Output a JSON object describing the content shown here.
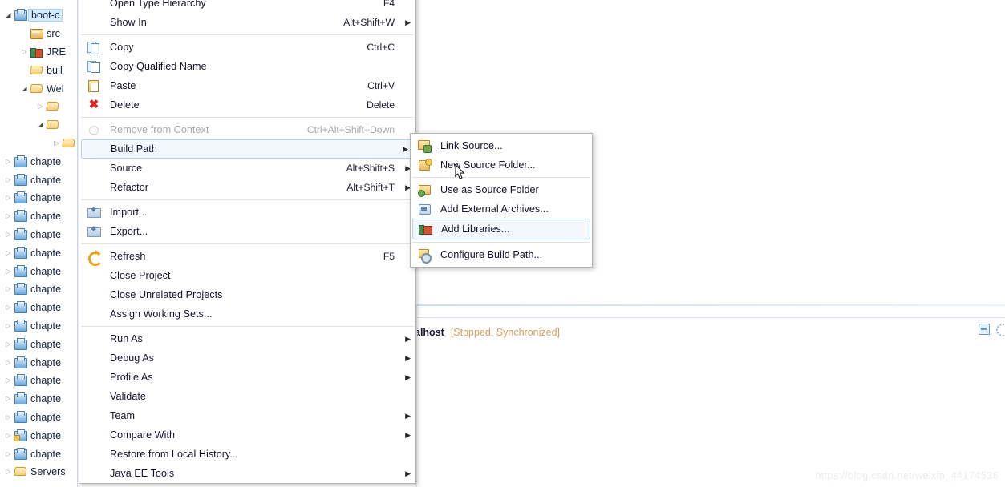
{
  "explorer": {
    "name": "package-explorer",
    "items": [
      {
        "label": "boot-c",
        "icon": "java-project-icon",
        "indent": 0,
        "twisty": "open",
        "selected": true
      },
      {
        "label": "src",
        "icon": "source-folder-icon",
        "indent": 1,
        "twisty": "none",
        "selected": false
      },
      {
        "label": "JRE",
        "icon": "library-icon",
        "indent": 1,
        "twisty": "closed",
        "selected": false
      },
      {
        "label": "buil",
        "icon": "folder-icon",
        "indent": 1,
        "twisty": "none",
        "selected": false
      },
      {
        "label": "Wel",
        "icon": "folder-icon",
        "indent": 1,
        "twisty": "open",
        "selected": false
      },
      {
        "label": "",
        "icon": "folder-icon",
        "indent": 2,
        "twisty": "closed",
        "selected": false
      },
      {
        "label": "",
        "icon": "folder-icon",
        "indent": 2,
        "twisty": "open",
        "selected": false
      },
      {
        "label": "",
        "icon": "folder-icon",
        "indent": 3,
        "twisty": "closed",
        "selected": false
      },
      {
        "label": "chapte",
        "icon": "java-project-icon",
        "indent": 0,
        "twisty": "closed",
        "selected": false
      },
      {
        "label": "chapte",
        "icon": "java-project-icon",
        "indent": 0,
        "twisty": "closed",
        "selected": false
      },
      {
        "label": "chapte",
        "icon": "java-project-icon",
        "indent": 0,
        "twisty": "closed",
        "selected": false
      },
      {
        "label": "chapte",
        "icon": "java-project-icon",
        "indent": 0,
        "twisty": "closed",
        "selected": false
      },
      {
        "label": "chapte",
        "icon": "java-project-icon",
        "indent": 0,
        "twisty": "closed",
        "selected": false
      },
      {
        "label": "chapte",
        "icon": "java-project-icon",
        "indent": 0,
        "twisty": "closed",
        "selected": false
      },
      {
        "label": "chapte",
        "icon": "java-project-icon",
        "indent": 0,
        "twisty": "closed",
        "selected": false
      },
      {
        "label": "chapte",
        "icon": "java-project-icon",
        "indent": 0,
        "twisty": "closed",
        "selected": false
      },
      {
        "label": "chapte",
        "icon": "java-project-icon",
        "indent": 0,
        "twisty": "closed",
        "selected": false
      },
      {
        "label": "chapte",
        "icon": "java-project-icon",
        "indent": 0,
        "twisty": "closed",
        "selected": false
      },
      {
        "label": "chapte",
        "icon": "java-project-icon",
        "indent": 0,
        "twisty": "closed",
        "selected": false
      },
      {
        "label": "chapte",
        "icon": "java-project-icon",
        "indent": 0,
        "twisty": "closed",
        "selected": false
      },
      {
        "label": "chapte",
        "icon": "java-project-icon",
        "indent": 0,
        "twisty": "closed",
        "selected": false
      },
      {
        "label": "chapte",
        "icon": "java-project-icon",
        "indent": 0,
        "twisty": "closed",
        "selected": false
      },
      {
        "label": "chapte",
        "icon": "java-project-icon",
        "indent": 0,
        "twisty": "closed",
        "selected": false
      },
      {
        "label": "chapte",
        "icon": "java-project-locked-icon",
        "indent": 0,
        "twisty": "closed",
        "selected": false
      },
      {
        "label": "chapte",
        "icon": "java-project-icon",
        "indent": 0,
        "twisty": "closed",
        "selected": false
      },
      {
        "label": "Servers",
        "icon": "folder-icon",
        "indent": 0,
        "twisty": "closed",
        "selected": false
      }
    ]
  },
  "context_menu": {
    "name": "project-context-menu",
    "items": [
      {
        "type": "item",
        "label": "Open Type Hierarchy",
        "accel": "F4",
        "icon": "",
        "arrow": false,
        "disabled": false,
        "highlight": false
      },
      {
        "type": "item",
        "label": "Show In",
        "accel": "Alt+Shift+W",
        "icon": "",
        "arrow": true,
        "disabled": false,
        "highlight": false
      },
      {
        "type": "sep"
      },
      {
        "type": "item",
        "label": "Copy",
        "accel": "Ctrl+C",
        "icon": "copy-icon",
        "arrow": false,
        "disabled": false,
        "highlight": false
      },
      {
        "type": "item",
        "label": "Copy Qualified Name",
        "accel": "",
        "icon": "copy-qualified-icon",
        "arrow": false,
        "disabled": false,
        "highlight": false
      },
      {
        "type": "item",
        "label": "Paste",
        "accel": "Ctrl+V",
        "icon": "paste-icon",
        "arrow": false,
        "disabled": false,
        "highlight": false
      },
      {
        "type": "item",
        "label": "Delete",
        "accel": "Delete",
        "icon": "delete-icon",
        "arrow": false,
        "disabled": false,
        "highlight": false
      },
      {
        "type": "sep"
      },
      {
        "type": "item",
        "label": "Remove from Context",
        "accel": "Ctrl+Alt+Shift+Down",
        "icon": "remove-context-icon",
        "arrow": false,
        "disabled": true,
        "highlight": false
      },
      {
        "type": "item",
        "label": "Build Path",
        "accel": "",
        "icon": "",
        "arrow": true,
        "disabled": false,
        "highlight": true
      },
      {
        "type": "item",
        "label": "Source",
        "accel": "Alt+Shift+S",
        "icon": "",
        "arrow": true,
        "disabled": false,
        "highlight": false
      },
      {
        "type": "item",
        "label": "Refactor",
        "accel": "Alt+Shift+T",
        "icon": "",
        "arrow": true,
        "disabled": false,
        "highlight": false
      },
      {
        "type": "sep"
      },
      {
        "type": "item",
        "label": "Import...",
        "accel": "",
        "icon": "import-icon",
        "arrow": false,
        "disabled": false,
        "highlight": false
      },
      {
        "type": "item",
        "label": "Export...",
        "accel": "",
        "icon": "export-icon",
        "arrow": false,
        "disabled": false,
        "highlight": false
      },
      {
        "type": "sep"
      },
      {
        "type": "item",
        "label": "Refresh",
        "accel": "F5",
        "icon": "refresh-icon",
        "arrow": false,
        "disabled": false,
        "highlight": false
      },
      {
        "type": "item",
        "label": "Close Project",
        "accel": "",
        "icon": "",
        "arrow": false,
        "disabled": false,
        "highlight": false
      },
      {
        "type": "item",
        "label": "Close Unrelated Projects",
        "accel": "",
        "icon": "",
        "arrow": false,
        "disabled": false,
        "highlight": false
      },
      {
        "type": "item",
        "label": "Assign Working Sets...",
        "accel": "",
        "icon": "",
        "arrow": false,
        "disabled": false,
        "highlight": false
      },
      {
        "type": "sep"
      },
      {
        "type": "item",
        "label": "Run As",
        "accel": "",
        "icon": "",
        "arrow": true,
        "disabled": false,
        "highlight": false
      },
      {
        "type": "item",
        "label": "Debug As",
        "accel": "",
        "icon": "",
        "arrow": true,
        "disabled": false,
        "highlight": false
      },
      {
        "type": "item",
        "label": "Profile As",
        "accel": "",
        "icon": "",
        "arrow": true,
        "disabled": false,
        "highlight": false
      },
      {
        "type": "item",
        "label": "Validate",
        "accel": "",
        "icon": "",
        "arrow": false,
        "disabled": false,
        "highlight": false
      },
      {
        "type": "item",
        "label": "Team",
        "accel": "",
        "icon": "",
        "arrow": true,
        "disabled": false,
        "highlight": false
      },
      {
        "type": "item",
        "label": "Compare With",
        "accel": "",
        "icon": "",
        "arrow": true,
        "disabled": false,
        "highlight": false
      },
      {
        "type": "item",
        "label": "Restore from Local History...",
        "accel": "",
        "icon": "",
        "arrow": false,
        "disabled": false,
        "highlight": false
      },
      {
        "type": "item",
        "label": "Java EE Tools",
        "accel": "",
        "icon": "",
        "arrow": true,
        "disabled": false,
        "highlight": false
      }
    ]
  },
  "submenu": {
    "name": "build-path-submenu",
    "items": [
      {
        "type": "item",
        "label": "Link Source...",
        "icon": "link-source-icon",
        "highlight": false
      },
      {
        "type": "item",
        "label": "New Source Folder...",
        "icon": "new-source-folder-icon",
        "highlight": false
      },
      {
        "type": "sep"
      },
      {
        "type": "item",
        "label": "Use as Source Folder",
        "icon": "use-as-source-icon",
        "highlight": false
      },
      {
        "type": "item",
        "label": "Add External Archives...",
        "icon": "add-external-archives-icon",
        "highlight": false
      },
      {
        "type": "item",
        "label": "Add Libraries...",
        "icon": "add-libraries-icon",
        "highlight": true
      },
      {
        "type": "sep"
      },
      {
        "type": "item",
        "label": "Configure Build Path...",
        "icon": "configure-build-path-icon",
        "highlight": false
      }
    ]
  },
  "servers_view": {
    "name": "servers-view",
    "server_name": "alhost",
    "server_status": "[Stopped, Synchronized]",
    "minimize_title": "Minimize",
    "restore_title": "Restore"
  },
  "watermark": {
    "text": "https://blog.csdn.net/weixin_44174536"
  },
  "colors": {
    "selection_blue": "#d4ecff",
    "menu_highlight_bg": "#f2f8fd",
    "menu_highlight_border": "#b8d6ef",
    "status_orange": "#d0a15f",
    "menu_border": "#b5b5b5"
  }
}
